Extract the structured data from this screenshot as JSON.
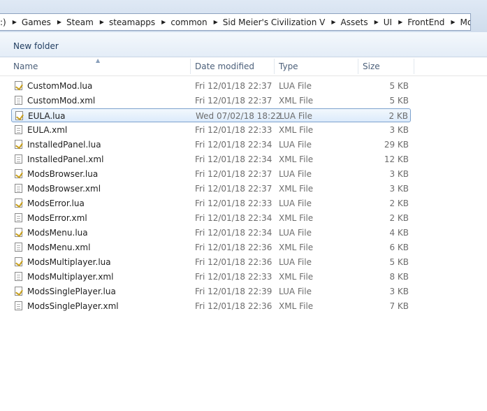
{
  "address": {
    "stub": ":)",
    "crumbs": [
      "Games",
      "Steam",
      "steamapps",
      "common",
      "Sid Meier's Civilization V",
      "Assets",
      "UI",
      "FrontEnd",
      "Modding"
    ]
  },
  "toolbar": {
    "new_folder": "New folder"
  },
  "columns": {
    "name": "Name",
    "date": "Date modified",
    "type": "Type",
    "size": "Size"
  },
  "files": [
    {
      "name": "CustomMod.lua",
      "date": "Fri 12/01/18 22:37",
      "type": "LUA File",
      "size": "5 KB",
      "icon": "lua-file-icon"
    },
    {
      "name": "CustomMod.xml",
      "date": "Fri 12/01/18 22:37",
      "type": "XML File",
      "size": "5 KB",
      "icon": "xml-file-icon"
    },
    {
      "name": "EULA.lua",
      "date": "Wed 07/02/18 18:22",
      "type": "LUA File",
      "size": "2 KB",
      "icon": "lua-file-icon",
      "selected": true
    },
    {
      "name": "EULA.xml",
      "date": "Fri 12/01/18 22:33",
      "type": "XML File",
      "size": "3 KB",
      "icon": "xml-file-icon"
    },
    {
      "name": "InstalledPanel.lua",
      "date": "Fri 12/01/18 22:34",
      "type": "LUA File",
      "size": "29 KB",
      "icon": "lua-file-icon"
    },
    {
      "name": "InstalledPanel.xml",
      "date": "Fri 12/01/18 22:34",
      "type": "XML File",
      "size": "12 KB",
      "icon": "xml-file-icon"
    },
    {
      "name": "ModsBrowser.lua",
      "date": "Fri 12/01/18 22:37",
      "type": "LUA File",
      "size": "3 KB",
      "icon": "lua-file-icon"
    },
    {
      "name": "ModsBrowser.xml",
      "date": "Fri 12/01/18 22:37",
      "type": "XML File",
      "size": "3 KB",
      "icon": "xml-file-icon"
    },
    {
      "name": "ModsError.lua",
      "date": "Fri 12/01/18 22:33",
      "type": "LUA File",
      "size": "2 KB",
      "icon": "lua-file-icon"
    },
    {
      "name": "ModsError.xml",
      "date": "Fri 12/01/18 22:34",
      "type": "XML File",
      "size": "2 KB",
      "icon": "xml-file-icon"
    },
    {
      "name": "ModsMenu.lua",
      "date": "Fri 12/01/18 22:34",
      "type": "LUA File",
      "size": "4 KB",
      "icon": "lua-file-icon"
    },
    {
      "name": "ModsMenu.xml",
      "date": "Fri 12/01/18 22:36",
      "type": "XML File",
      "size": "6 KB",
      "icon": "xml-file-icon"
    },
    {
      "name": "ModsMultiplayer.lua",
      "date": "Fri 12/01/18 22:36",
      "type": "LUA File",
      "size": "5 KB",
      "icon": "lua-file-icon"
    },
    {
      "name": "ModsMultiplayer.xml",
      "date": "Fri 12/01/18 22:33",
      "type": "XML File",
      "size": "8 KB",
      "icon": "xml-file-icon"
    },
    {
      "name": "ModsSinglePlayer.lua",
      "date": "Fri 12/01/18 22:39",
      "type": "LUA File",
      "size": "3 KB",
      "icon": "lua-file-icon"
    },
    {
      "name": "ModsSinglePlayer.xml",
      "date": "Fri 12/01/18 22:36",
      "type": "XML File",
      "size": "7 KB",
      "icon": "xml-file-icon"
    }
  ]
}
